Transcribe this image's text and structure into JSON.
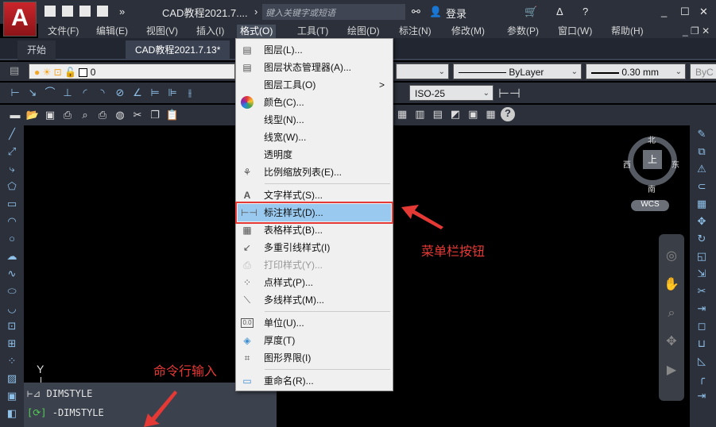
{
  "title_bar": {
    "app_logo": "A",
    "doc_title": "CAD教程2021.7....",
    "search_placeholder": "键入关键字或短语",
    "login": "登录"
  },
  "menu_bar": [
    "文件(F)",
    "编辑(E)",
    "视图(V)",
    "插入(I)",
    "格式(O)",
    "工具(T)",
    "绘图(D)",
    "标注(N)",
    "修改(M)",
    "参数(P)",
    "窗口(W)",
    "帮助(H)"
  ],
  "tabs": [
    "开始",
    "CAD教程2021.7.13*"
  ],
  "layer_toolbar": {
    "layer": "0"
  },
  "properties": {
    "linetype": "ByLayer",
    "lineweight": "0.30 mm",
    "plotstyle": "ByC",
    "dimstyle": "ISO-25"
  },
  "format_menu": [
    {
      "label": "图层(L)...",
      "icon": "layer-icon"
    },
    {
      "label": "图层状态管理器(A)...",
      "icon": "layer-state-icon"
    },
    {
      "label": "图层工具(O)",
      "icon": "",
      "submenu": ">"
    },
    {
      "label": "颜色(C)...",
      "icon": "color-wheel-icon"
    },
    {
      "label": "线型(N)...",
      "icon": ""
    },
    {
      "label": "线宽(W)...",
      "icon": ""
    },
    {
      "label": "透明度",
      "icon": ""
    },
    {
      "label": "比例缩放列表(E)...",
      "icon": "scale-list-icon"
    },
    {
      "label": "文字样式(S)...",
      "icon": "text-style-icon"
    },
    {
      "label": "标注样式(D)...",
      "icon": "dim-style-icon"
    },
    {
      "label": "表格样式(B)...",
      "icon": "table-style-icon"
    },
    {
      "label": "多重引线样式(I)",
      "icon": "mleader-style-icon"
    },
    {
      "label": "打印样式(Y)...",
      "icon": "plot-style-icon"
    },
    {
      "label": "点样式(P)...",
      "icon": "point-style-icon"
    },
    {
      "label": "多线样式(M)...",
      "icon": "mline-style-icon"
    },
    {
      "label": "单位(U)...",
      "icon": "units-icon"
    },
    {
      "label": "厚度(T)",
      "icon": "thickness-icon"
    },
    {
      "label": "图形界限(I)",
      "icon": "limits-icon"
    },
    {
      "label": "重命名(R)...",
      "icon": "rename-icon"
    }
  ],
  "viewcube": {
    "north": "北",
    "south": "南",
    "east": "东",
    "west": "西",
    "top": "上",
    "wcs": "WCS"
  },
  "annotations": {
    "menu": "菜单栏按钮",
    "cmd": "命令行输入"
  },
  "command_suggestions": [
    "DIMSTYLE",
    "-DIMSTYLE"
  ],
  "ucs_y": "Y",
  "colors": {
    "accent": "#e53935",
    "highlight": "#99c9ef"
  }
}
